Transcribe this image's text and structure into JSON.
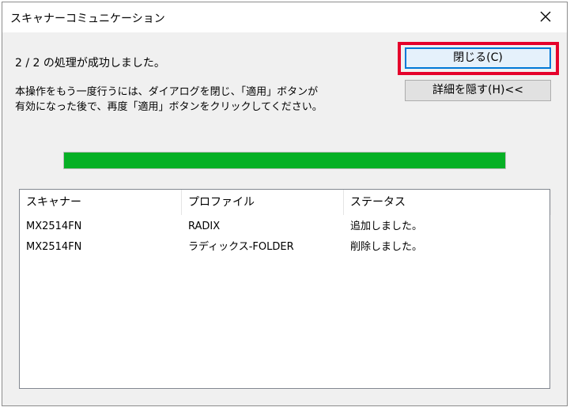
{
  "window": {
    "title": "スキャナーコミュニケーション"
  },
  "status": {
    "message": "2 / 2 の処理が成功しました。"
  },
  "instructions": {
    "line1": "本操作をもう一度行うには、ダイアログを閉じ、「適用」ボタンが",
    "line2": "有効になった後で、再度「適用」ボタンをクリックしてください。"
  },
  "buttons": {
    "close_label": "閉じる(C)",
    "hide_details_label": "詳細を隠す(H)<<"
  },
  "progress": {
    "fraction": 1.0,
    "color": "#06b025"
  },
  "list": {
    "columns": [
      "スキャナー",
      "プロファイル",
      "ステータス"
    ],
    "rows": [
      {
        "scanner": "MX2514FN",
        "profile": "RADIX",
        "status": "追加しました。"
      },
      {
        "scanner": "MX2514FN",
        "profile": "ラディックス-FOLDER",
        "status": "削除しました。"
      }
    ]
  },
  "colors": {
    "highlight": "#e5002b",
    "default_button_border": "#0078d7"
  }
}
